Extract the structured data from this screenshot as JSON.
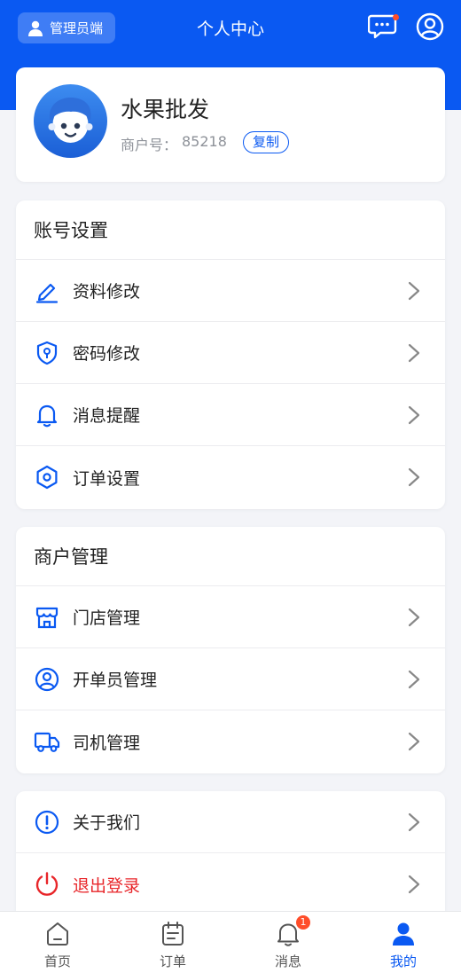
{
  "header": {
    "title": "个人中心",
    "admin_label": "管理员端",
    "message_icon": "chat-bubble-icon",
    "user_icon": "user-circle-icon"
  },
  "profile": {
    "name": "水果批发",
    "merchant_label": "商户号：",
    "merchant_id": "85218",
    "copy_label": "复制"
  },
  "account_settings": {
    "title": "账号设置",
    "items": [
      {
        "label": "资料修改",
        "icon": "edit-pen-icon"
      },
      {
        "label": "密码修改",
        "icon": "shield-key-icon"
      },
      {
        "label": "消息提醒",
        "icon": "bell-icon"
      },
      {
        "label": "订单设置",
        "icon": "hexagon-settings-icon"
      }
    ]
  },
  "merchant_management": {
    "title": "商户管理",
    "items": [
      {
        "label": "门店管理",
        "icon": "store-icon"
      },
      {
        "label": "开单员管理",
        "icon": "person-circle-icon"
      },
      {
        "label": "司机管理",
        "icon": "truck-icon"
      }
    ]
  },
  "misc": {
    "items": [
      {
        "label": "关于我们",
        "icon": "info-exclaim-icon"
      },
      {
        "label": "退出登录",
        "icon": "power-icon"
      }
    ]
  },
  "tabbar": {
    "tabs": [
      {
        "label": "首页",
        "icon": "home-icon"
      },
      {
        "label": "订单",
        "icon": "order-calendar-icon"
      },
      {
        "label": "消息",
        "icon": "bell-icon",
        "badge": "1"
      },
      {
        "label": "我的",
        "icon": "person-icon"
      }
    ]
  },
  "colors": {
    "primary": "#0a59f2",
    "danger": "#e8262a",
    "badge": "#ff4d2a"
  }
}
